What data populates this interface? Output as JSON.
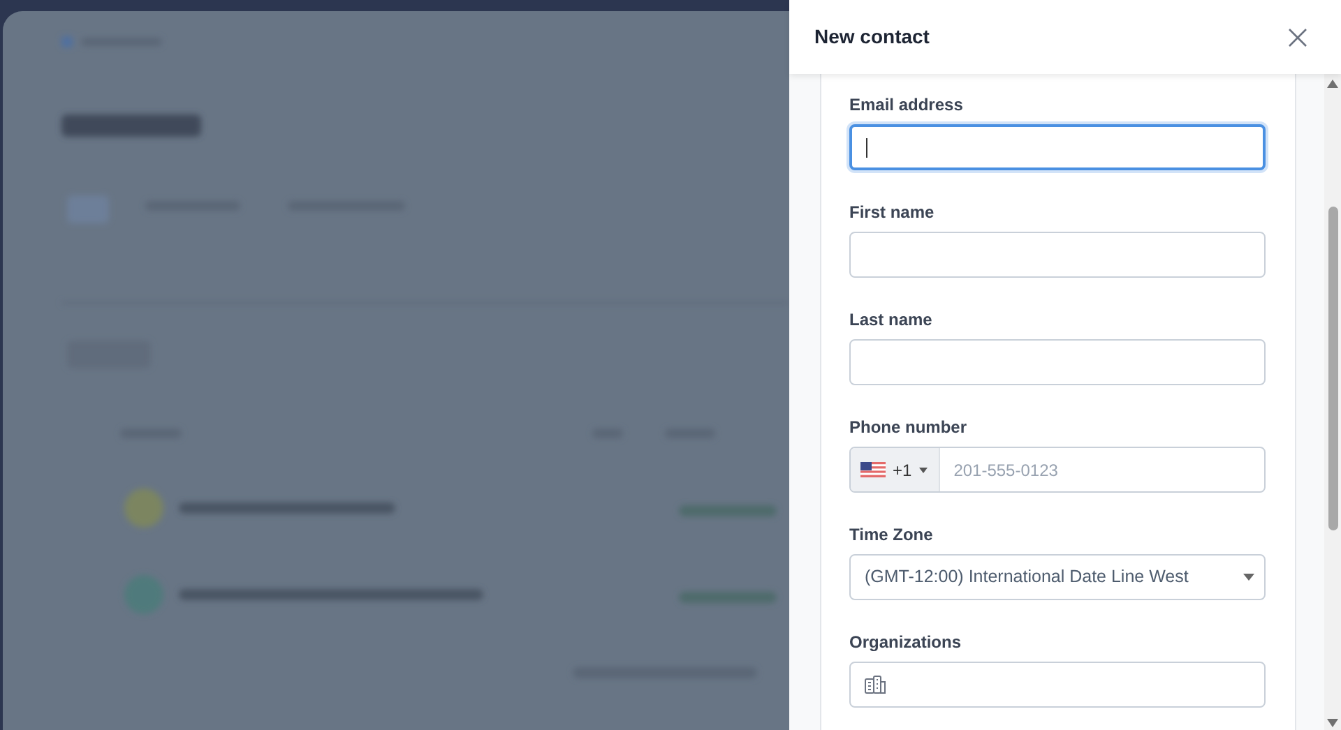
{
  "dialog": {
    "title": "New contact"
  },
  "fields": [
    {
      "kind": "text",
      "label": "Email address",
      "focused": true
    },
    {
      "kind": "text",
      "label": "First name",
      "focused": false
    },
    {
      "kind": "text",
      "label": "Last name",
      "focused": false
    },
    {
      "kind": "phone",
      "label": "Phone number",
      "dial_code": "+1",
      "placeholder": "201-555-0123",
      "focused": false
    },
    {
      "kind": "select",
      "label": "Time Zone",
      "value": "(GMT-12:00) International Date Line West",
      "focused": false
    },
    {
      "kind": "organization",
      "label": "Organizations",
      "focused": false
    }
  ]
}
